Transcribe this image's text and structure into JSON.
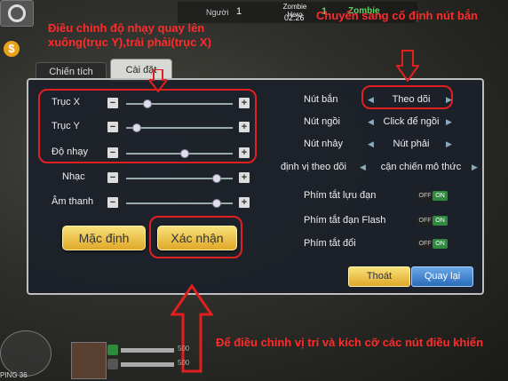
{
  "top": {
    "team1_label": "Người",
    "team1_score": "1",
    "mode_line1": "Zombie",
    "mode_line2": "Hero",
    "timer": "02:26",
    "team2_score": "1",
    "team2_label": "Zombie",
    "coin_symbol": "$"
  },
  "tabs": {
    "stats": "Chiến tích",
    "settings": "Cài đặt"
  },
  "sliders": [
    {
      "label": "Trục X",
      "level": 0.2
    },
    {
      "label": "Trục Y",
      "level": 0.1
    },
    {
      "label": "Độ nhạy",
      "level": 0.55
    },
    {
      "label": "Nhạc",
      "level": 0.85
    },
    {
      "label": "Âm thanh",
      "level": 0.85
    }
  ],
  "options": [
    {
      "label": "Nút bắn",
      "value": "Theo dõi"
    },
    {
      "label": "Nút ngồi",
      "value": "Click để ngồi"
    },
    {
      "label": "Nút nhảy",
      "value": "Nút phải"
    },
    {
      "label": "định vị theo dõi",
      "value": "cận chiến mô thức"
    }
  ],
  "toggles": [
    {
      "label": "Phím tắt lựu đạn",
      "off": "OFF",
      "on": "ON"
    },
    {
      "label": "Phím tắt đạn Flash",
      "off": "OFF",
      "on": "ON"
    },
    {
      "label": "Phím tắt đổi",
      "off": "OFF",
      "on": "ON"
    }
  ],
  "buttons": {
    "default": "Mặc định",
    "confirm": "Xác nhận",
    "exit": "Thoát",
    "back": "Quay lại"
  },
  "annotations": {
    "sensitivity": "Điều chỉnh độ nhạy quay lên xuống(trục Y),trái phải(trục X)",
    "fire_button": "Chuyển sang cố định nút bắn",
    "controls": "Để điều chỉnh vị trí và kích cỡ các nút điều khiển"
  },
  "hud": {
    "ping": "PING 36",
    "value1": "500",
    "value2": "500"
  },
  "colors": {
    "annotation": "#ff2b2b",
    "panel_bg": "#1c2028",
    "gold_button": "#e0a828",
    "blue_button": "#2a6ab8"
  }
}
